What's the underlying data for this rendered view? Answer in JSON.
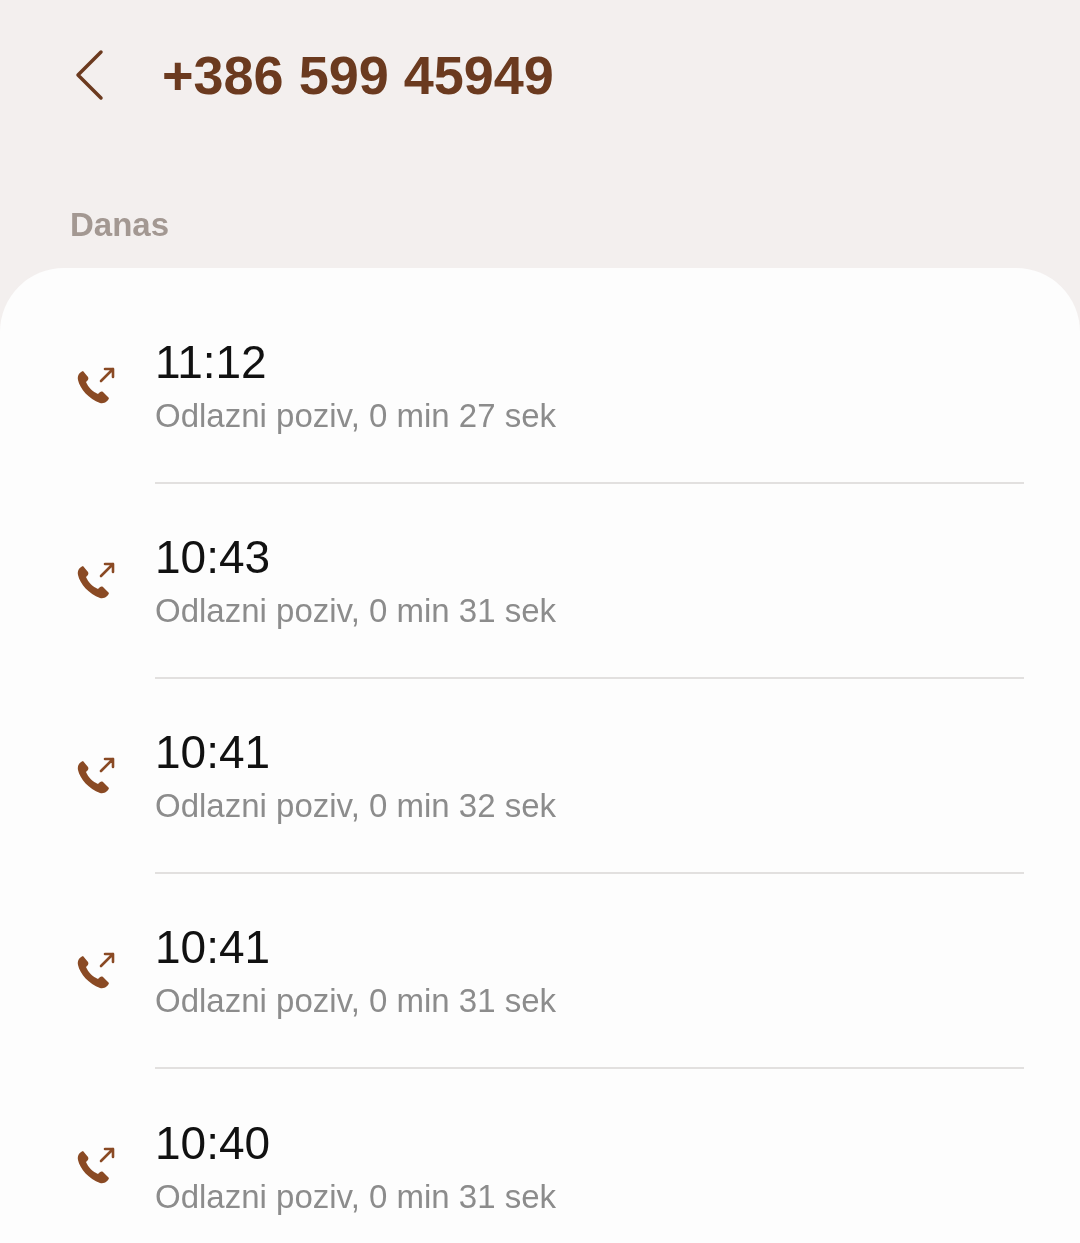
{
  "header": {
    "title": "+386 599 45949"
  },
  "section": {
    "label": "Danas"
  },
  "calls": [
    {
      "kind": "outgoing",
      "time": "11:12",
      "detail": "Odlazni poziv, 0 min 27 sek"
    },
    {
      "kind": "outgoing",
      "time": "10:43",
      "detail": "Odlazni poziv, 0 min 31 sek"
    },
    {
      "kind": "outgoing",
      "time": "10:41",
      "detail": "Odlazni poziv, 0 min 32 sek"
    },
    {
      "kind": "outgoing",
      "time": "10:41",
      "detail": "Odlazni poziv, 0 min 31 sek"
    },
    {
      "kind": "outgoing",
      "time": "10:40",
      "detail": "Odlazni poziv, 0 min 31 sek"
    }
  ]
}
